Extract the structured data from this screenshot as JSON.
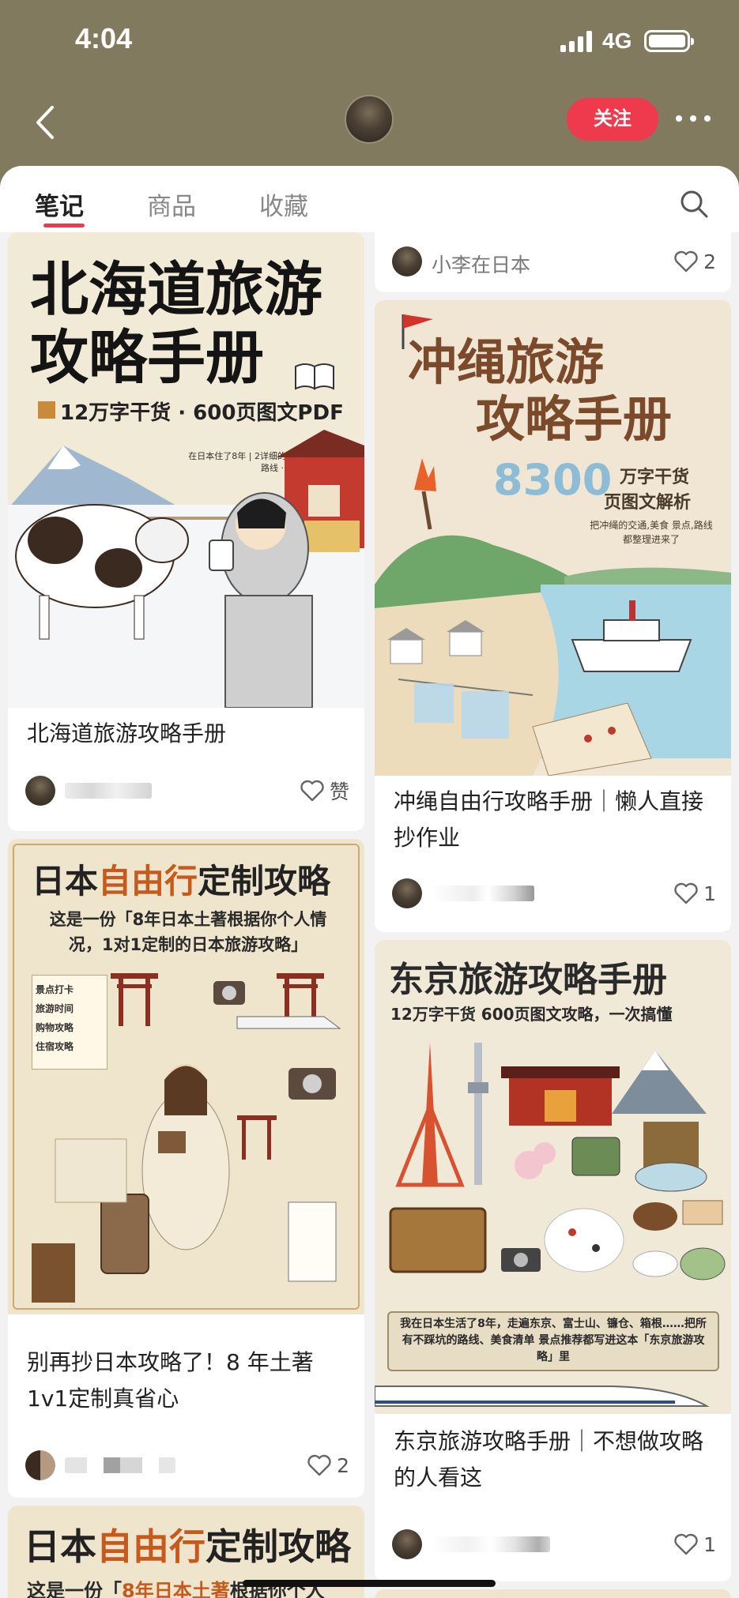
{
  "status_bar": {
    "time": "4:04",
    "network": "4G"
  },
  "nav": {
    "follow_label": "关注"
  },
  "tabs": [
    {
      "label": "笔记",
      "active": true
    },
    {
      "label": "商品",
      "active": false
    },
    {
      "label": "收藏",
      "active": false
    }
  ],
  "colors": {
    "header_bg": "#827a5f",
    "accent": "#ee3a4c"
  },
  "cards": {
    "top_right_author": "小李在日本",
    "top_right_likes": "2",
    "hokkaido": {
      "poster_line1": "北海道旅游",
      "poster_line2": "攻略手册",
      "poster_sub": "12万字干货 · 600页图文PDF",
      "poster_note": "在日本住了8年 | 2详细的北海道深度游指南 路线 · 美食 · 玩法全都有",
      "title": "北海道旅游攻略手册",
      "likes": "赞"
    },
    "okinawa": {
      "poster_line1": "冲绳旅游",
      "poster_line2": "攻略手册",
      "poster_num": "8300",
      "poster_sub1": "万字干货",
      "poster_sub2": "页图文解析",
      "poster_note": "把冲绳的交通,美食 景点,路线都整理进来了",
      "title": "冲绳自由行攻略手册｜懒人直接抄作业",
      "likes": "1"
    },
    "custom_japan": {
      "poster_title_a": "日本",
      "poster_title_b": "自由行",
      "poster_title_c": "定制攻略",
      "poster_sub": "这是一份「8年日本土著根据你个人情况，1对1定制的日本旅游攻略」",
      "checklist": [
        "景点打卡",
        "旅游时间",
        "购物攻略",
        "住宿攻略"
      ],
      "title": "别再抄日本攻略了！8 年土著1v1定制真省心",
      "likes": "2"
    },
    "tokyo": {
      "poster_title": "东京旅游攻略手册",
      "poster_sub": "12万字干货 600页图文攻略，一次搞懂",
      "poster_note": "我在日本生活了8年，走遍东京、富士山、镰仓、箱根……把所有不踩坑的路线、美食清单 景点推荐都写进这本「东京旅游攻略」里",
      "title": "东京旅游攻略手册｜不想做攻略的人看这",
      "likes": "1"
    },
    "custom_japan_2": {
      "poster_title_a": "日本",
      "poster_title_b": "自由行",
      "poster_title_c": "定制攻略",
      "poster_sub_a": "这是一份「",
      "poster_sub_b": "8年日本土著",
      "poster_sub_c": "根据你个人"
    }
  }
}
